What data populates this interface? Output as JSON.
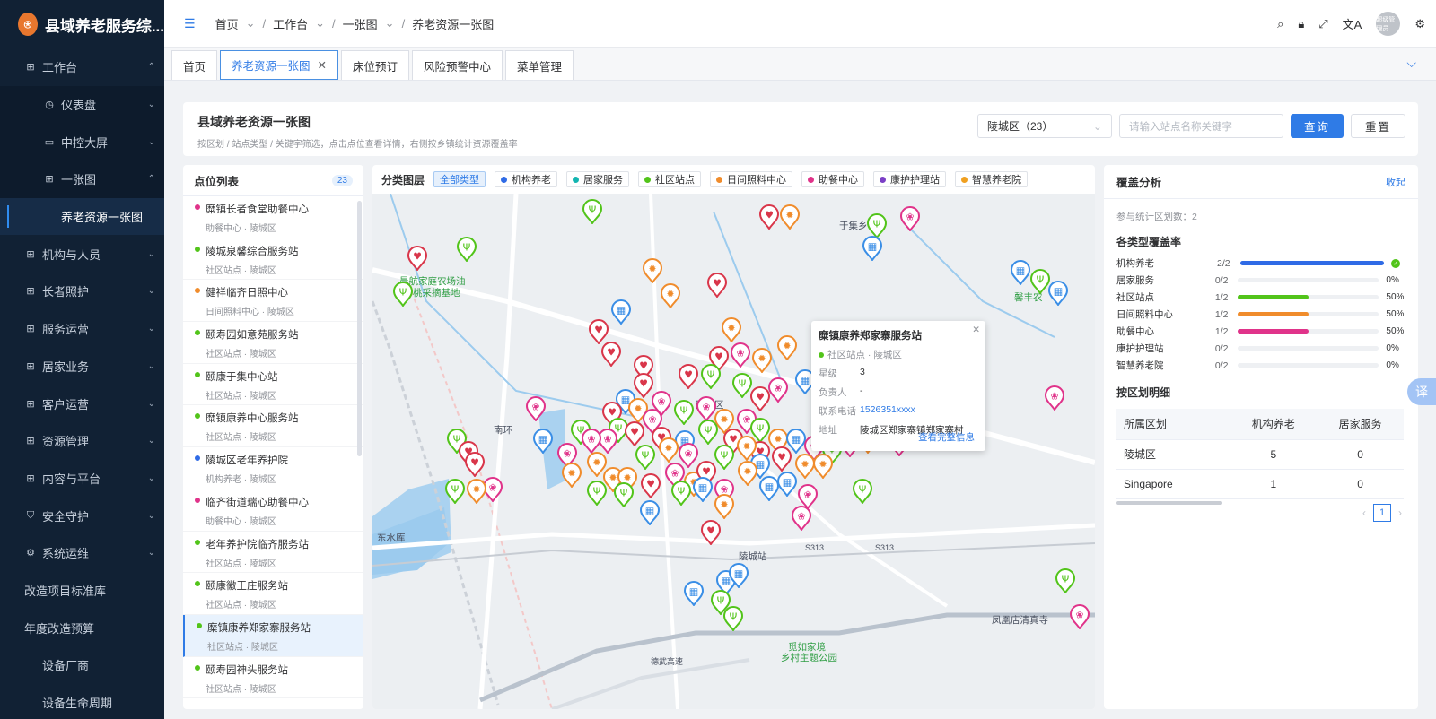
{
  "app": {
    "title": "县域养老服务综..."
  },
  "sidebar": {
    "items": [
      {
        "label": "工作台",
        "icon": "grid-icon",
        "chev": "⌃"
      },
      {
        "label": "仪表盘",
        "icon": "dashboard-icon",
        "chev": "⌄"
      },
      {
        "label": "中控大屏",
        "icon": "screen-icon",
        "chev": "⌄"
      },
      {
        "label": "一张图",
        "icon": "grid-icon",
        "chev": "⌃"
      },
      {
        "label": "养老资源一张图"
      },
      {
        "label": "机构与人员",
        "icon": "grid-icon",
        "chev": "⌄"
      },
      {
        "label": "长者照护",
        "icon": "grid-icon",
        "chev": "⌄"
      },
      {
        "label": "服务运营",
        "icon": "grid-icon",
        "chev": "⌄"
      },
      {
        "label": "居家业务",
        "icon": "grid-icon",
        "chev": "⌄"
      },
      {
        "label": "客户运营",
        "icon": "grid-icon",
        "chev": "⌄"
      },
      {
        "label": "资源管理",
        "icon": "grid-icon",
        "chev": "⌄"
      },
      {
        "label": "内容与平台",
        "icon": "grid-icon",
        "chev": "⌄"
      },
      {
        "label": "安全守护",
        "icon": "shield-icon",
        "chev": "⌄"
      },
      {
        "label": "系统运维",
        "icon": "gear-icon",
        "chev": "⌄"
      },
      {
        "label": "改造项目标准库"
      },
      {
        "label": "年度改造预算"
      },
      {
        "label": "设备厂商"
      },
      {
        "label": "设备生命周期"
      }
    ]
  },
  "header": {
    "breadcrumb": [
      "首页",
      "工作台",
      "一张图",
      "养老资源一张图"
    ],
    "avatar": "超级管理员"
  },
  "tabs": [
    "首页",
    "养老资源一张图",
    "床位预订",
    "风险预警中心",
    "菜单管理"
  ],
  "page": {
    "title": "县域养老资源一张图",
    "subtitle": "按区划 / 站点类型 / 关键字筛选，点击点位查看详情，右侧按乡镇统计资源覆盖率",
    "district_select": "陵城区（23）",
    "search_placeholder": "请输入站点名称关键字",
    "query_btn": "查询",
    "reset_btn": "重置"
  },
  "list": {
    "title": "点位列表",
    "count": "23",
    "items": [
      {
        "name": "糜镇长者食堂助餐中心",
        "sub": "助餐中心 · 陵城区",
        "color": "#e0338a"
      },
      {
        "name": "陵城泉馨综合服务站",
        "sub": "社区站点 · 陵城区",
        "color": "#52c41a"
      },
      {
        "name": "健祥临齐日照中心",
        "sub": "日间照料中心 · 陵城区",
        "color": "#f08c2c"
      },
      {
        "name": "颐寿园如意苑服务站",
        "sub": "社区站点 · 陵城区",
        "color": "#52c41a"
      },
      {
        "name": "颐康于集中心站",
        "sub": "社区站点 · 陵城区",
        "color": "#52c41a"
      },
      {
        "name": "糜镇康养中心服务站",
        "sub": "社区站点 · 陵城区",
        "color": "#52c41a"
      },
      {
        "name": "陵城区老年养护院",
        "sub": "机构养老 · 陵城区",
        "color": "#2f6be6"
      },
      {
        "name": "临齐街道瑞心助餐中心",
        "sub": "助餐中心 · 陵城区",
        "color": "#e0338a"
      },
      {
        "name": "老年养护院临齐服务站",
        "sub": "社区站点 · 陵城区",
        "color": "#52c41a"
      },
      {
        "name": "颐康徽王庄服务站",
        "sub": "社区站点 · 陵城区",
        "color": "#52c41a"
      },
      {
        "name": "糜镇康养郑家寨服务站",
        "sub": "社区站点 · 陵城区",
        "color": "#52c41a",
        "selected": true
      },
      {
        "name": "颐寿园神头服务站",
        "sub": "社区站点 · 陵城区",
        "color": "#52c41a"
      }
    ]
  },
  "legend": {
    "title": "分类图层",
    "all": "全部类型",
    "types": [
      {
        "label": "机构养老",
        "color": "#2f6be6"
      },
      {
        "label": "居家服务",
        "color": "#13b5b1"
      },
      {
        "label": "社区站点",
        "color": "#52c41a"
      },
      {
        "label": "日间照料中心",
        "color": "#f08c2c"
      },
      {
        "label": "助餐中心",
        "color": "#e0338a"
      },
      {
        "label": "康护护理站",
        "color": "#7b3fc6"
      },
      {
        "label": "智慧养老院",
        "color": "#f0a020"
      }
    ]
  },
  "map": {
    "labels": [
      "于集乡",
      "晨航家庭农场油",
      "桃采摘基地",
      "馨丰农",
      "南环",
      "陵城区",
      "东水库",
      "陵城站",
      "凤凰店清真寺",
      "觅如家境",
      "乡村主题公园",
      "S313",
      "S313",
      "德武高速"
    ]
  },
  "popup": {
    "title": "糜镇康养郑家寨服务站",
    "tag": "社区站点 · 陵城区",
    "rows": [
      {
        "k": "星级",
        "v": "3"
      },
      {
        "k": "负责人",
        "v": "-"
      },
      {
        "k": "联系电话",
        "v": "1526351xxxx"
      },
      {
        "k": "地址",
        "v": "陵城区郑家寨镇郑家寨村"
      }
    ],
    "more": "查看完整信息"
  },
  "analysis": {
    "title": "覆盖分析",
    "collapse": "收起",
    "count_text": "参与统计区划数：2",
    "coverage_title": "各类型覆盖率",
    "coverage": [
      {
        "name": "机构养老",
        "frac": "2/2",
        "pct": "",
        "value": 1.0,
        "color": "#2f6be6"
      },
      {
        "name": "居家服务",
        "frac": "0/2",
        "pct": "0%",
        "value": 0,
        "color": "#13b5b1"
      },
      {
        "name": "社区站点",
        "frac": "1/2",
        "pct": "50%",
        "value": 0.5,
        "color": "#52c41a"
      },
      {
        "name": "日间照料中心",
        "frac": "1/2",
        "pct": "50%",
        "value": 0.5,
        "color": "#f08c2c"
      },
      {
        "name": "助餐中心",
        "frac": "1/2",
        "pct": "50%",
        "value": 0.5,
        "color": "#e0338a"
      },
      {
        "name": "康护护理站",
        "frac": "0/2",
        "pct": "0%",
        "value": 0,
        "color": "#7b3fc6"
      },
      {
        "name": "智慧养老院",
        "frac": "0/2",
        "pct": "0%",
        "value": 0,
        "color": "#f0a020"
      }
    ],
    "detail_title": "按区划明细",
    "table": {
      "headers": [
        "所属区划",
        "机构养老",
        "居家服务"
      ],
      "rows": [
        [
          "陵城区",
          "5",
          "0"
        ],
        [
          "Singapore",
          "1",
          "0"
        ]
      ]
    },
    "page": "1"
  }
}
